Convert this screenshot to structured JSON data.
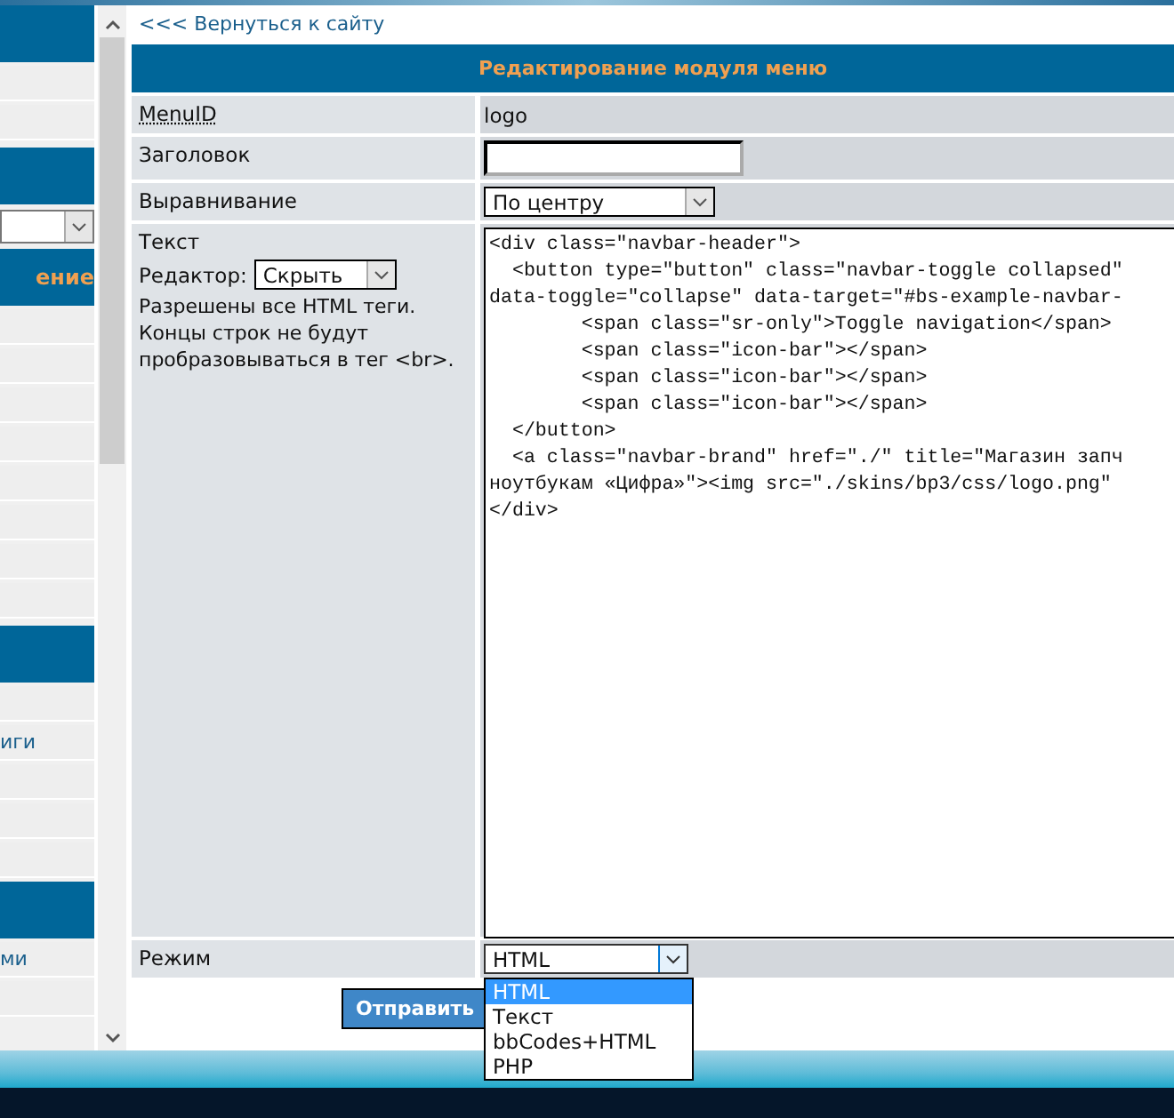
{
  "sidebar": [
    {
      "kind": "header"
    },
    {
      "kind": "item"
    },
    {
      "kind": "item"
    },
    {
      "kind": "gap"
    },
    {
      "kind": "header"
    },
    {
      "kind": "select"
    },
    {
      "kind": "header",
      "text": "ение"
    },
    {
      "kind": "item"
    },
    {
      "kind": "item"
    },
    {
      "kind": "item"
    },
    {
      "kind": "item"
    },
    {
      "kind": "item"
    },
    {
      "kind": "item"
    },
    {
      "kind": "item"
    },
    {
      "kind": "item"
    },
    {
      "kind": "gap"
    },
    {
      "kind": "header"
    },
    {
      "kind": "item"
    },
    {
      "kind": "item",
      "text": "иги"
    },
    {
      "kind": "item"
    },
    {
      "kind": "item"
    },
    {
      "kind": "item"
    },
    {
      "kind": "header"
    },
    {
      "kind": "item",
      "text": "ми"
    },
    {
      "kind": "item"
    }
  ],
  "back_link": "<<< Вернуться к сайту",
  "form_title": "Редактирование модуля меню",
  "rows": [
    {
      "kind": "static",
      "label": "MenuID",
      "value": "logo"
    },
    {
      "kind": "input",
      "label": "Заголовок"
    },
    {
      "kind": "select",
      "label": "Выравнивание",
      "value": "По центру"
    },
    {
      "kind": "code",
      "label": "Текст",
      "editor_label": "Редактор:",
      "editor_value": "Скрыть",
      "note": "Разрешены все HTML теги. Концы строк не будут пробразовываться в тег <br>.",
      "lines": [
        "<div class=\"navbar-header\">",
        "  <button type=\"button\" class=\"navbar-toggle collapsed\"",
        "data-toggle=\"collapse\" data-target=\"#bs-example-navbar-",
        "        <span class=\"sr-only\">Toggle navigation</span>",
        "        <span class=\"icon-bar\"></span>",
        "        <span class=\"icon-bar\"></span>",
        "        <span class=\"icon-bar\"></span>",
        "  </button>",
        "  <a class=\"navbar-brand\" href=\"./\" title=\"Магазин запч",
        "ноутбукам «Цифра»\"><img src=\"./skins/bp3/css/logo.png\"",
        "</div>"
      ]
    },
    {
      "kind": "dropdown",
      "label": "Режим",
      "value": "HTML",
      "options": [
        {
          "label": "HTML",
          "selected": true
        },
        {
          "label": "Текст",
          "selected": false
        },
        {
          "label": "bbCodes+HTML",
          "selected": false
        },
        {
          "label": "PHP",
          "selected": false
        }
      ]
    }
  ],
  "submit": "Отправить"
}
